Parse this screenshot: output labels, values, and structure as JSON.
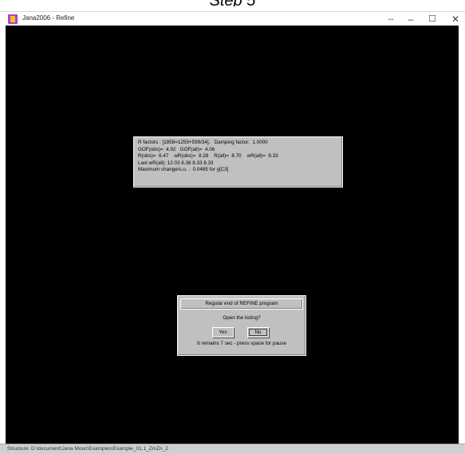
{
  "caption": "Step 5",
  "window": {
    "title": "Jana2006 - Refine",
    "controls": {
      "resize": "↔",
      "minimize": "–",
      "maximize": "☐",
      "close": "✕"
    }
  },
  "rfactors_panel": {
    "lines": [
      "R factors : [1858=1259+599/34],   Damping factor:  1.0000",
      "GOF(obs)=  4.92   GOF(all)=  4.06",
      "R(obs)=  6.47    wR(obs)=  8.28    R(all)=  8.70    wR(all)=  8.33",
      "Last wR(all): 12.03 8.36 8.33 8.33",
      "Maximum change/s.u. :  0.0485 for y[C3]"
    ]
  },
  "dialog": {
    "header": "Regular end of REFINE program",
    "question": "Open the listing?",
    "yes_label": "Yes",
    "no_label": "No",
    "countdown": "It remains  7 sec - press space for pause"
  },
  "statusbar": {
    "text": "Structure: D:\\document\\Jana Mooc\\Examples\\Example_01.1_Zn\\Zn_2"
  }
}
